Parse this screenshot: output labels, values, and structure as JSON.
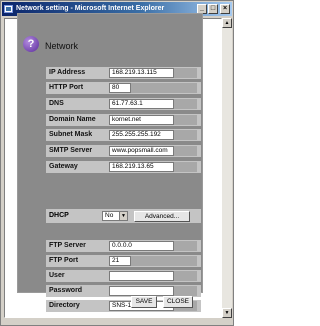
{
  "window": {
    "title": "Network setting - Microsoft Internet Explorer"
  },
  "titlebar_buttons": {
    "minimize": "_",
    "maximize": "□",
    "close": "×"
  },
  "page": {
    "title": "Network",
    "icon": "question-mark-icon",
    "icon_glyph": "?"
  },
  "network_fields": [
    {
      "label": "IP Address",
      "value": "168.219.13.115"
    },
    {
      "label": "HTTP Port",
      "value": "80"
    },
    {
      "label": "DNS",
      "value": "61.77.63.1"
    },
    {
      "label": "Domain Name",
      "value": "kornet.net"
    },
    {
      "label": "Subnet Mask",
      "value": "255.255.255.192"
    },
    {
      "label": "SMTP Server",
      "value": "www.popsmall.com"
    },
    {
      "label": "Gateway",
      "value": "168.219.13.65"
    }
  ],
  "dhcp": {
    "label": "DHCP",
    "selected": "No",
    "advanced_label": "Advanced..."
  },
  "ftp_fields": [
    {
      "label": "FTP Server",
      "value": "0.0.0.0"
    },
    {
      "label": "FTP Port",
      "value": "21"
    },
    {
      "label": "User",
      "value": ""
    },
    {
      "label": "Password",
      "value": ""
    },
    {
      "label": "Directory",
      "value": "SNS-110"
    }
  ],
  "buttons": {
    "save": "SAVE",
    "close": "CLOSE"
  },
  "colors": {
    "titlebar": "#0a246a",
    "panel": "#8a8a8a",
    "row_bg": "#c4c4c4",
    "icon_purple": "#5a2a9a"
  }
}
